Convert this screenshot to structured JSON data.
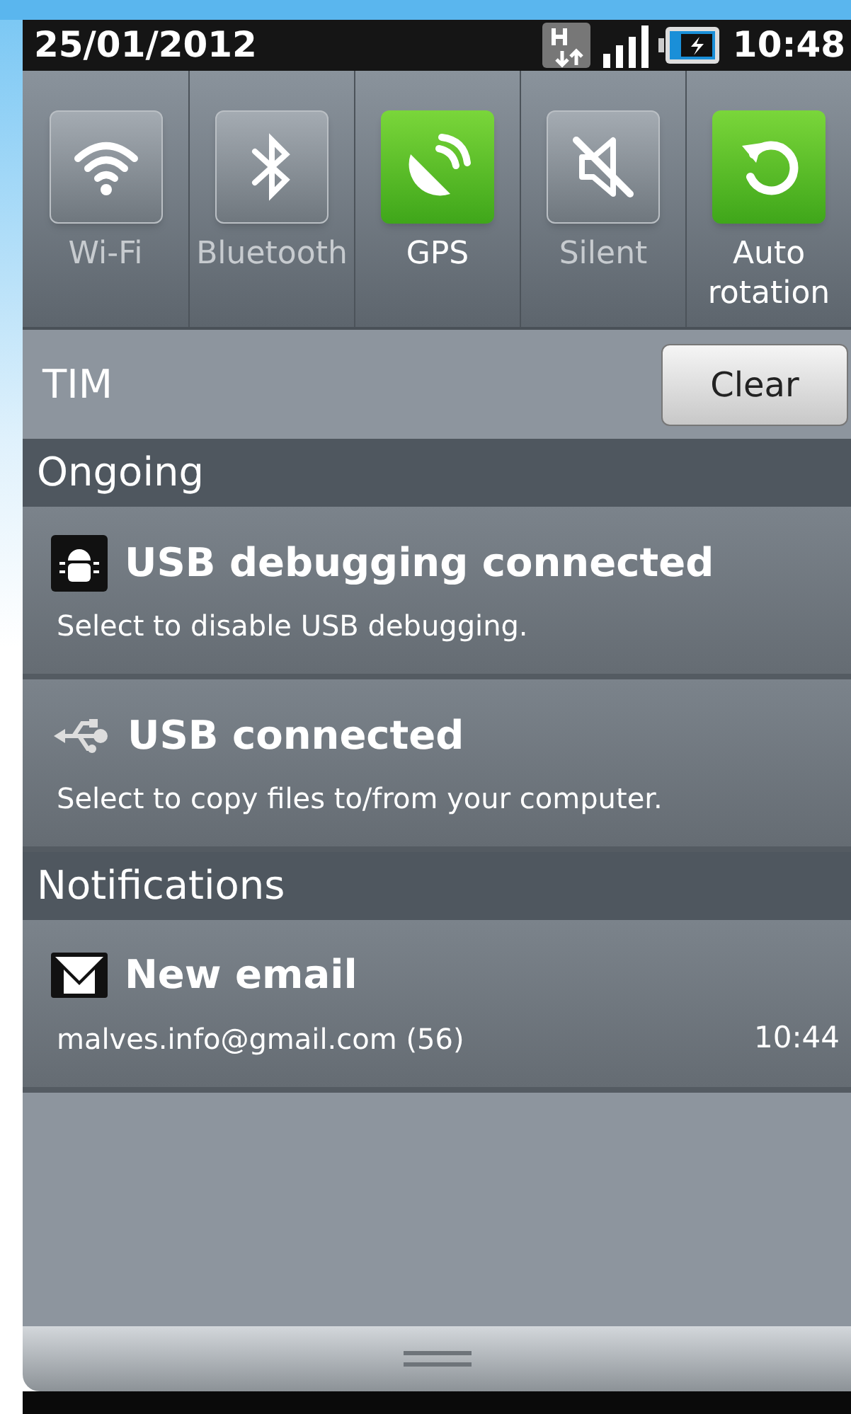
{
  "status_bar": {
    "date": "25/01/2012",
    "time": "10:48"
  },
  "toggles": [
    {
      "kind": "wifi",
      "label": "Wi-Fi",
      "on": false
    },
    {
      "kind": "bluetooth",
      "label": "Bluetooth",
      "on": false
    },
    {
      "kind": "gps",
      "label": "GPS",
      "on": true
    },
    {
      "kind": "silent",
      "label": "Silent",
      "on": false
    },
    {
      "kind": "rotation",
      "label": "Auto rotation",
      "on": true
    }
  ],
  "carrier": "TIM",
  "clear_button": "Clear",
  "sections": [
    {
      "title": "Ongoing",
      "items": [
        {
          "kind": "debug",
          "title": "USB debugging connected",
          "text": "Select to disable USB debugging."
        },
        {
          "kind": "usb",
          "title": "USB connected",
          "text": "Select to copy files to/from your computer."
        }
      ]
    },
    {
      "title": "Notifications",
      "items": [
        {
          "kind": "email",
          "title": "New email",
          "text": "malves.info@gmail.com (56)",
          "time": "10:44"
        }
      ]
    }
  ]
}
